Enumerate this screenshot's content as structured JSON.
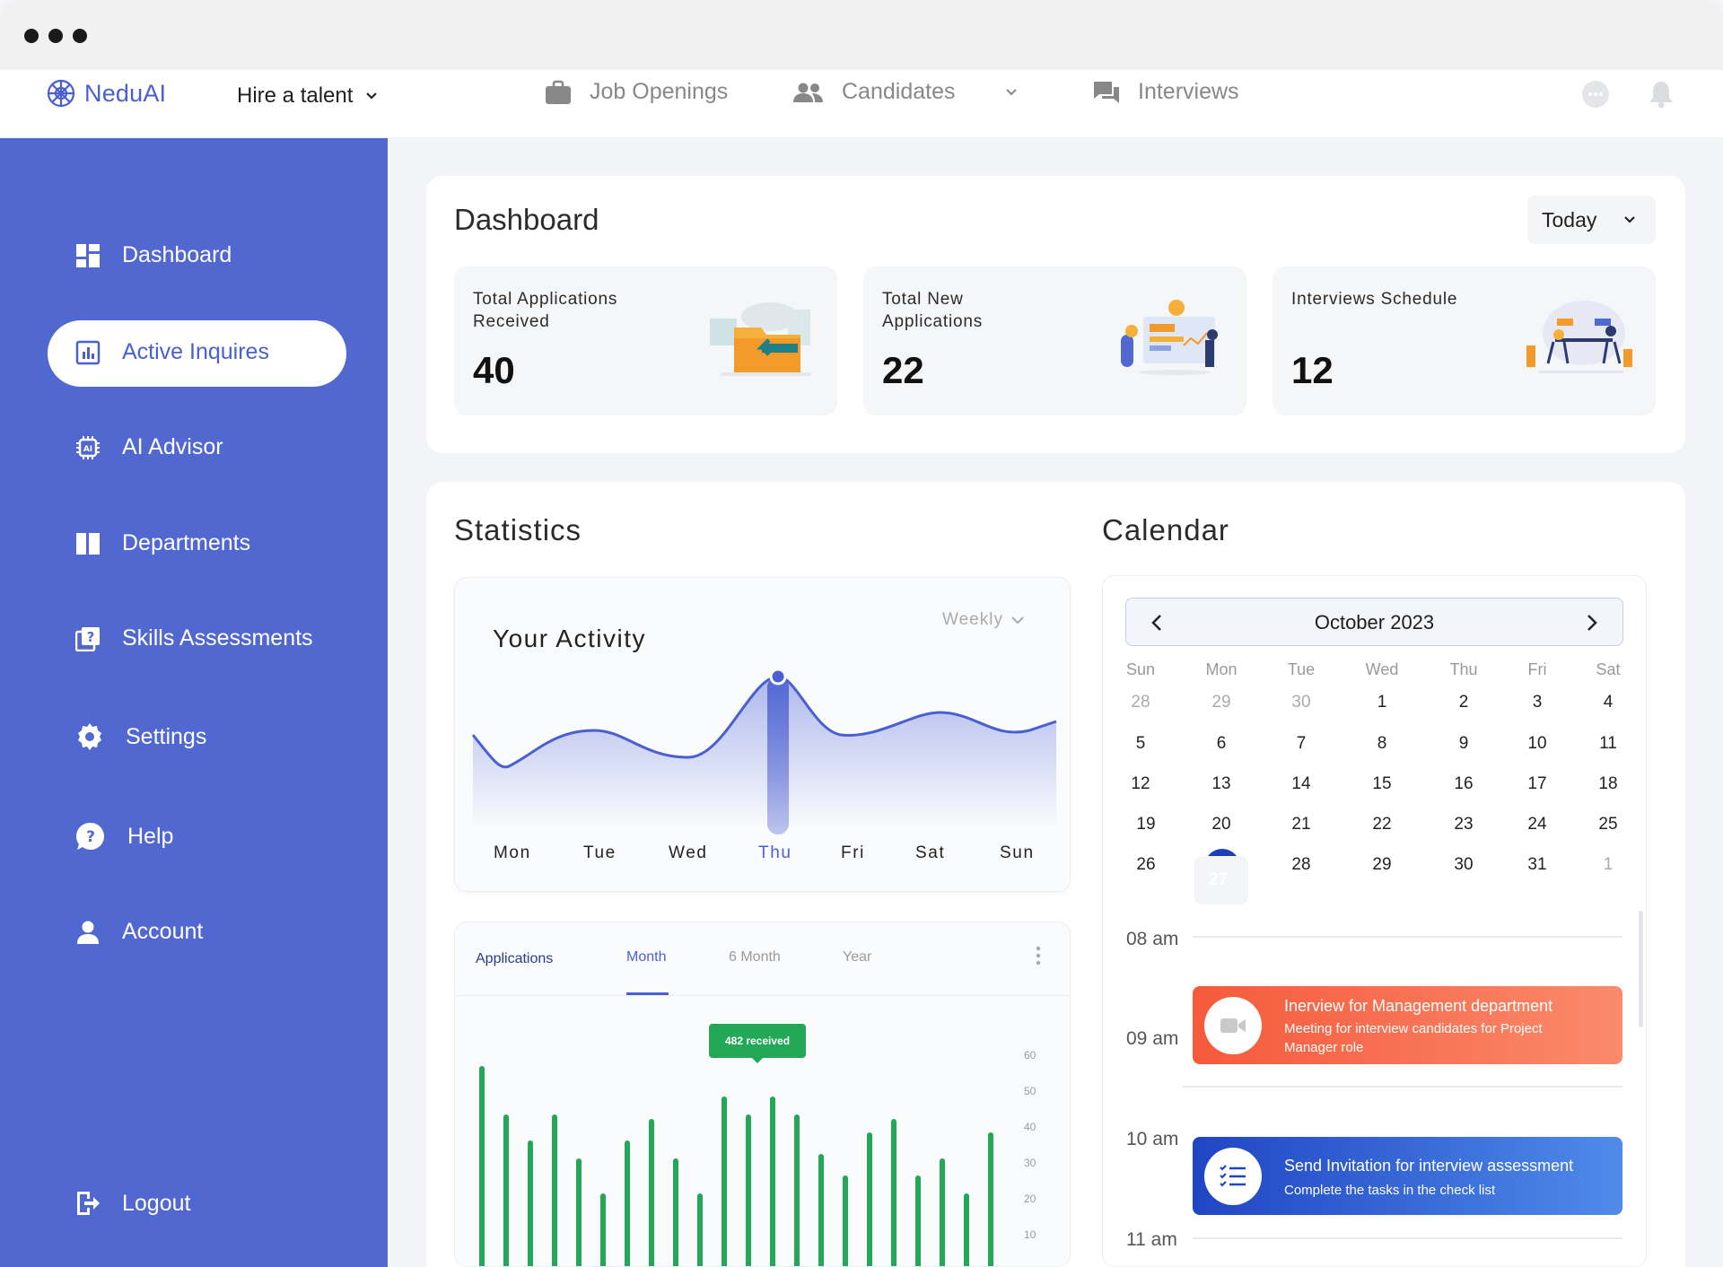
{
  "brand": {
    "name": "NeduAI"
  },
  "topnav": {
    "hire_label": "Hire a talent",
    "items": [
      {
        "label": "Job Openings",
        "icon": "briefcase-icon"
      },
      {
        "label": "Candidates",
        "icon": "people-icon"
      },
      {
        "label": "Interviews",
        "icon": "chat-icon"
      }
    ]
  },
  "sidebar": {
    "items": [
      {
        "label": "Dashboard",
        "icon": "grid-icon"
      },
      {
        "label": "Active Inquires",
        "icon": "chart-board-icon",
        "active": true
      },
      {
        "label": "AI Advisor",
        "icon": "ai-chip-icon"
      },
      {
        "label": "Departments",
        "icon": "columns-icon"
      },
      {
        "label": "Skills Assessments",
        "icon": "quiz-icon"
      },
      {
        "label": "Settings",
        "icon": "gear-icon"
      },
      {
        "label": "Help",
        "icon": "help-icon"
      },
      {
        "label": "Account",
        "icon": "user-icon"
      },
      {
        "label": "Logout",
        "icon": "logout-icon"
      }
    ]
  },
  "dashboard": {
    "title": "Dashboard",
    "range": "Today",
    "stats": [
      {
        "label": "Total Applications Received",
        "value": "40"
      },
      {
        "label": "Total New Applications",
        "value": "22"
      },
      {
        "label": "Interviews Schedule",
        "value": "12"
      }
    ]
  },
  "statistics": {
    "title": "Statistics",
    "activity": {
      "title": "Your Activity",
      "period": "Weekly",
      "days": [
        "Mon",
        "Tue",
        "Wed",
        "Thu",
        "Fri",
        "Sat",
        "Sun"
      ],
      "selected_day": "Thu"
    },
    "applications": {
      "title": "Applications",
      "tabs": [
        "Month",
        "6 Month",
        "Year"
      ],
      "active_tab": "Month",
      "tooltip": "482 received",
      "y_ticks": [
        "60",
        "50",
        "40",
        "30",
        "20",
        "10"
      ]
    }
  },
  "calendar": {
    "title": "Calendar",
    "month": "October 2023",
    "weekdays": [
      "Sun",
      "Mon",
      "Tue",
      "Wed",
      "Thu",
      "Fri",
      "Sat"
    ],
    "weeks": [
      [
        "28",
        "29",
        "30",
        "1",
        "2",
        "3",
        "4"
      ],
      [
        "5",
        "6",
        "7",
        "8",
        "9",
        "10",
        "11"
      ],
      [
        "12",
        "13",
        "14",
        "15",
        "16",
        "17",
        "18"
      ],
      [
        "19",
        "20",
        "21",
        "22",
        "23",
        "24",
        "25"
      ],
      [
        "26",
        "27",
        "28",
        "29",
        "30",
        "31",
        "1"
      ]
    ],
    "today": "27",
    "times": [
      "08 am",
      "09 am",
      "10 am",
      "11 am"
    ],
    "events": [
      {
        "title": "Inerview for Management department",
        "subtitle": "Meeting for interview candidates for  Project Manager role",
        "icon": "video-camera-icon",
        "color": "#f86a4f"
      },
      {
        "title": "Send Invitation for interview assessment",
        "subtitle": "Complete the tasks in the check list",
        "icon": "checklist-icon",
        "color": "#2c5ad6"
      }
    ]
  },
  "colors": {
    "primary": "#5168d1",
    "accent": "#4a5fd1",
    "green": "#22a857",
    "orange": "#f86a4f"
  }
}
